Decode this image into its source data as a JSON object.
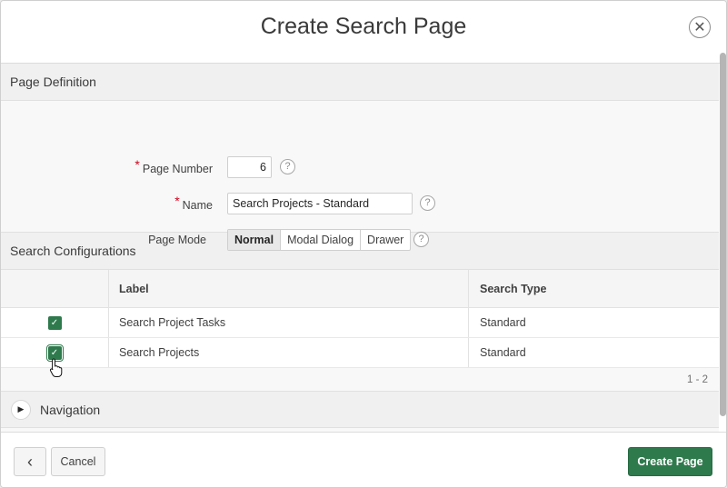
{
  "dialog": {
    "title": "Create Search Page",
    "close_icon": "close-icon"
  },
  "page_definition": {
    "heading": "Page Definition",
    "page_number_label": "Page Number",
    "page_number_value": "6",
    "name_label": "Name",
    "name_value": "Search Projects - Standard",
    "page_mode_label": "Page Mode",
    "modes": [
      "Normal",
      "Modal Dialog",
      "Drawer"
    ],
    "selected_mode": "Normal",
    "required_marker": "*",
    "help_glyph": "?"
  },
  "search_configurations": {
    "heading": "Search Configurations",
    "columns": [
      "Label",
      "Search Type"
    ],
    "rows": [
      {
        "checked": true,
        "label": "Search Project Tasks",
        "type": "Standard"
      },
      {
        "checked": true,
        "label": "Search Projects",
        "type": "Standard"
      }
    ],
    "pagination": "1 - 2"
  },
  "navigation": {
    "heading": "Navigation"
  },
  "footer": {
    "back_glyph": "‹",
    "cancel": "Cancel",
    "create": "Create Page"
  },
  "colors": {
    "primary": "#2f7a4d",
    "required": "#d0021b"
  }
}
